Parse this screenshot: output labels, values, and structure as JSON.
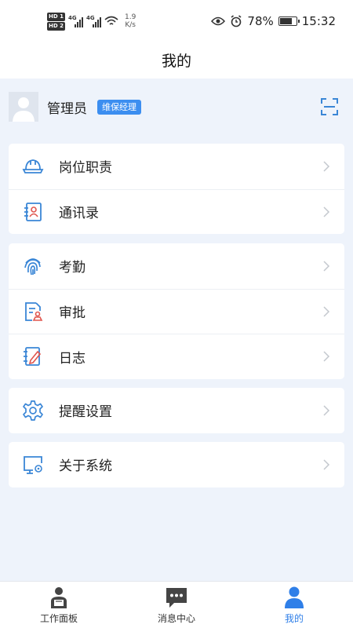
{
  "status_bar": {
    "hd1": "HD 1",
    "hd2": "HD 2",
    "network1": "4G",
    "network2": "4G",
    "speed_value": "1.9",
    "speed_unit": "K/s",
    "battery_text": "78%",
    "battery_level_percent": 78,
    "time": "15:32",
    "icons": [
      "eye-icon",
      "alarm-icon",
      "battery-icon",
      "wifi-icon",
      "signal-icon"
    ]
  },
  "header": {
    "title": "我的"
  },
  "profile": {
    "name": "管理员",
    "role": "维保经理",
    "scan_icon": "scan-icon"
  },
  "menu_groups": [
    {
      "items": [
        {
          "label": "岗位职责",
          "icon": "helmet-icon"
        },
        {
          "label": "通讯录",
          "icon": "contacts-icon"
        }
      ]
    },
    {
      "items": [
        {
          "label": "考勤",
          "icon": "fingerprint-icon"
        },
        {
          "label": "审批",
          "icon": "approval-icon"
        },
        {
          "label": "日志",
          "icon": "log-icon"
        }
      ]
    },
    {
      "items": [
        {
          "label": "提醒设置",
          "icon": "gear-icon"
        }
      ]
    },
    {
      "items": [
        {
          "label": "关于系统",
          "icon": "monitor-settings-icon"
        }
      ]
    }
  ],
  "tabs": [
    {
      "label": "工作面板",
      "icon": "worker-icon"
    },
    {
      "label": "消息中心",
      "icon": "chat-bubble-icon"
    },
    {
      "label": "我的",
      "icon": "user-icon"
    }
  ],
  "colors": {
    "accent": "#2f7fe8",
    "badge": "#3c8ef0",
    "page_bg": "#eef3fb",
    "icon_blue": "#3a86d6",
    "icon_red": "#e0564f"
  }
}
